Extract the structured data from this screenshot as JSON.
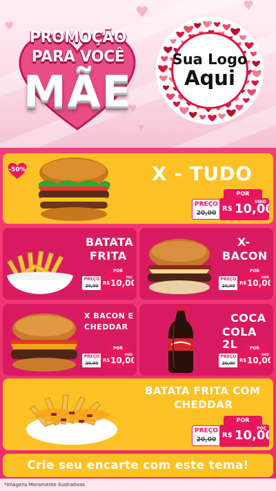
{
  "header": {
    "promo_line1": "PROMOÇÃO",
    "promo_line2": "PARA VOCÊ",
    "promo_line3": "MÃE",
    "logo_line1": "Sua Logo",
    "logo_line2": "Aqui"
  },
  "products": [
    {
      "id": "x-tudo",
      "title": "X - TUDO",
      "discount": "-50%",
      "price_label": "PREÇO",
      "old_price": "20,00",
      "por_label": "POR",
      "currency": "R$",
      "price": "10,00",
      "unit": "UNID"
    },
    {
      "id": "batata-frita",
      "title_line1": "BATATA",
      "title_line2": "FRITA",
      "price_label": "PREÇO",
      "old_price": "20,00",
      "por_label": "POR",
      "currency": "R$",
      "price": "10,00",
      "unit": "POÇ"
    },
    {
      "id": "x-bacon",
      "title_line1": "X-",
      "title_line2": "BACON",
      "price_label": "PREÇO",
      "old_price": "20,00",
      "por_label": "POR",
      "currency": "R$",
      "price": "10,00",
      "unit": "UNID"
    },
    {
      "id": "x-bacon-cheddar",
      "title_line1": "X BACON E",
      "title_line2": "CHEDDAR",
      "price_label": "PREÇO",
      "old_price": "20,00",
      "por_label": "POR",
      "currency": "R$",
      "price": "10,00",
      "unit": "UNID"
    },
    {
      "id": "coca-cola",
      "title_line1": "COCA",
      "title_line2": "COLA 2L",
      "price_label": "PREÇO",
      "old_price": "20,00",
      "por_label": "POR",
      "currency": "R$",
      "price": "10,00",
      "unit": "UNID"
    },
    {
      "id": "batata-cheddar",
      "title_line1": "BATATA FRITA COM",
      "title_line2": "CHEDDAR",
      "price_label": "PREÇO",
      "old_price": "20,00",
      "por_label": "POR",
      "currency": "R$",
      "price": "10,00",
      "unit": "POÇ"
    }
  ],
  "cta": "Crie seu encarte com este tema!",
  "footer": "*Imagens Meramente Ilustrativas",
  "colors": {
    "pink": "#ec2c6d",
    "dark_pink": "#d81b60",
    "yellow": "#fcc125",
    "tag_pink": "#e8175d"
  },
  "icons": {
    "burger": "burger-icon",
    "fries": "fries-icon",
    "cola": "cola-bottle-icon",
    "heart": "heart-icon"
  }
}
